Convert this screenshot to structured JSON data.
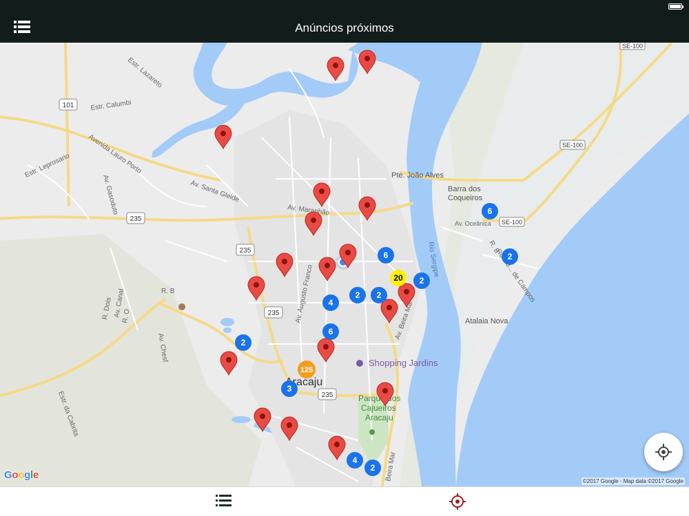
{
  "header": {
    "title": "Anúncios próximos"
  },
  "icons": {
    "menu": "list-icon",
    "locate": "crosshair-icon",
    "tab_list": "list-icon",
    "tab_nearby": "target-icon"
  },
  "colors": {
    "bar": "#121c1a",
    "pin": "#e94a44",
    "cluster_blue": "#1a73e8",
    "cluster_yellow": "#fff200",
    "cluster_orange": "#f39c1f",
    "water": "#a3cbf7",
    "land": "#ececec",
    "tab_active": "#9b1d23"
  },
  "map": {
    "labels": {
      "estr_lazareto": "Estr. Lazareto",
      "estr_calumbi": "Estr. Calumbi",
      "avenida_lauro_porto": "Avenida Lauro Porto",
      "estr_leprosario": "Estr. Leprosario",
      "av_gasoduto": "Av. Gasoduto",
      "av_santa_gleide": "Av. Santa Gleide",
      "av_maranhao": "Av. Maranhão",
      "pte_joao_alves": "Pte. João Alves",
      "barra_dos_coqueiros_1": "Barra dos",
      "barra_dos_coqueiros_2": "Coqueiros",
      "av_oceanica": "Av. Oceânica",
      "rod_campos": "Rod. J... de Campos",
      "rio_sergipe": "Rio Sergipe",
      "av_augusto_franco": "Av. Augusto Franco",
      "av_beira_mar": "Av. Beira Mar",
      "beira_mar": "Beira Mar",
      "atalaia_nova": "Atalaia Nova",
      "shopping_jardins": "Shopping Jardins",
      "aracaju": "Aracaju",
      "parque_1": "Parque dos",
      "parque_2": "Cajueiros",
      "parque_3": "Aracaju",
      "av_chesf": "Av. Chesf",
      "estr_da_cabrita": "Estr. da Cabrita",
      "rb_left": "R. B",
      "rb_right": "R. B",
      "r_dois": "R. Dois",
      "av_canal": "Av. Canal",
      "r_o": "R. O"
    },
    "shields": {
      "r101": "101",
      "r235_a": "235",
      "r235_b": "235",
      "r235_c": "235",
      "r235_d": "235",
      "se100_a": "SE-100",
      "se100_b": "SE-100",
      "se100_c": "SE-100"
    },
    "clusters": [
      {
        "count": "6",
        "color": "blue"
      },
      {
        "count": "2",
        "color": "blue"
      },
      {
        "count": "6",
        "color": "blue"
      },
      {
        "count": "20",
        "color": "yellow"
      },
      {
        "count": "2",
        "color": "blue"
      },
      {
        "count": "2",
        "color": "blue"
      },
      {
        "count": "2",
        "color": "blue"
      },
      {
        "count": "4",
        "color": "blue"
      },
      {
        "count": "6",
        "color": "blue"
      },
      {
        "count": "2",
        "color": "blue"
      },
      {
        "count": "125",
        "color": "orange"
      },
      {
        "count": "3",
        "color": "blue"
      },
      {
        "count": "4",
        "color": "blue"
      },
      {
        "count": "2",
        "color": "blue"
      }
    ],
    "pin_count": 18
  },
  "footer": {
    "google": "Google",
    "attribution": "©2017 Google - Map data ©2017 Google"
  }
}
